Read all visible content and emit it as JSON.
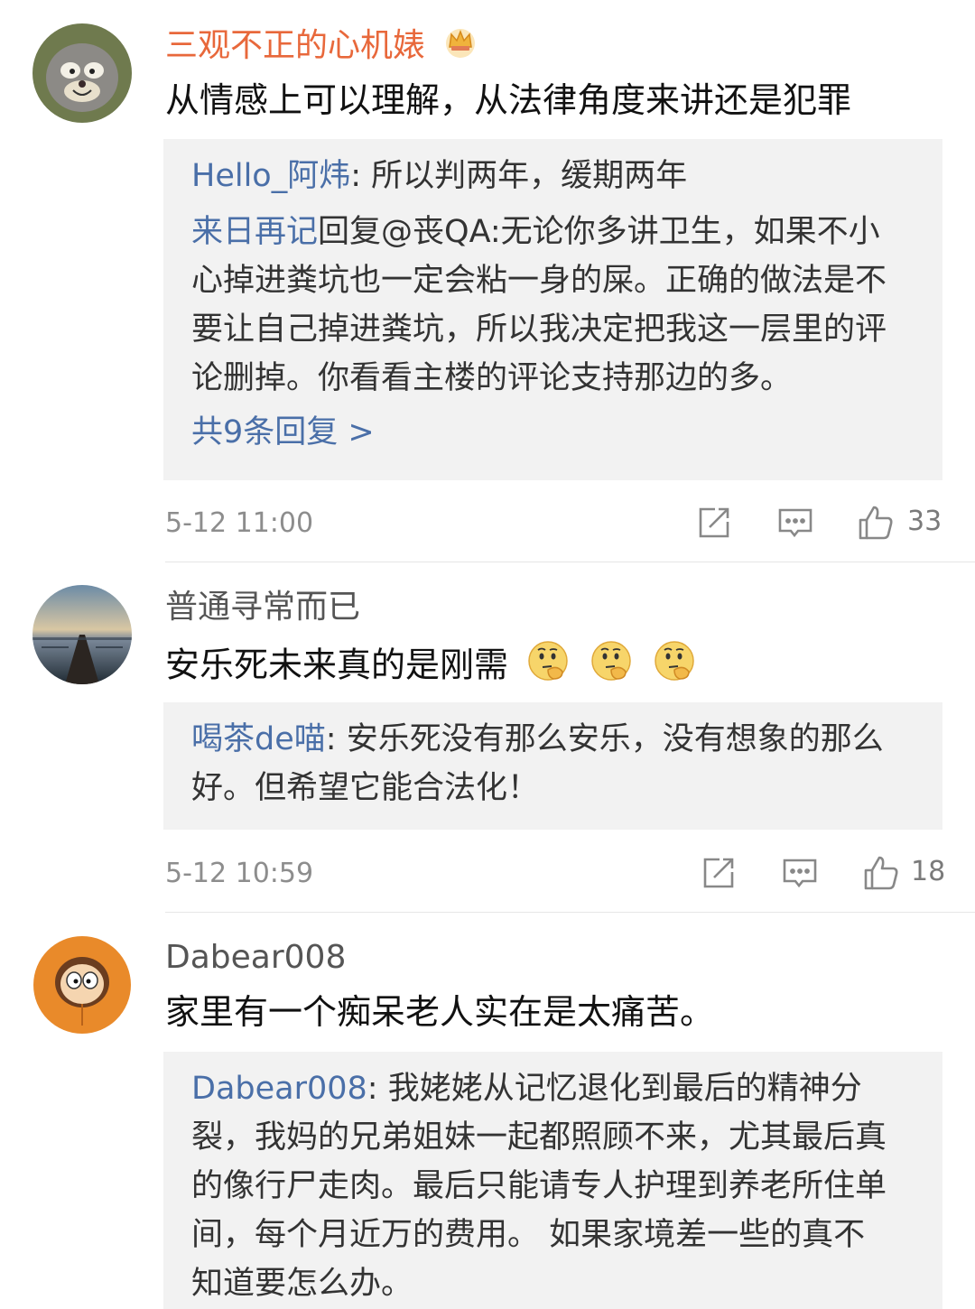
{
  "comments": [
    {
      "username": "三观不正的心机婊",
      "badge": "crown-badge-icon",
      "text": "从情感上可以理解，从法律角度来讲还是犯罪",
      "replies": [
        {
          "name": "Hello_阿炜",
          "sep": ": ",
          "text": "所以判两年，缓期两年"
        },
        {
          "name": "来日再记",
          "sep": "",
          "text_lines": [
            "回复@丧QA:无论你多讲卫生，如果不小",
            "心掉进粪坑也一定会粘一身的屎。正确的做法是不",
            "要让自己掉进粪坑，所以我决定把我这一层里的评",
            "论删掉。你看看主楼的评论支持那边的多。"
          ]
        }
      ],
      "more": "共9条回复 >",
      "time": "5-12 11:00",
      "likes": "33"
    },
    {
      "username": "普通寻常而已",
      "text": "安乐死未来真的是刚需",
      "emojis": [
        "thinking-face-icon",
        "thinking-face-icon",
        "thinking-face-icon"
      ],
      "replies": [
        {
          "name": "喝茶de喵",
          "sep": ": ",
          "text_lines": [
            "安乐死没有那么安乐，没有想象的那么",
            "好。但希望它能合法化！"
          ]
        }
      ],
      "time": "5-12 10:59",
      "likes": "18"
    },
    {
      "username": "Dabear008",
      "text": "家里有一个痴呆老人实在是太痛苦。",
      "replies": [
        {
          "name": "Dabear008",
          "sep": ": ",
          "text_lines": [
            "我姥姥从记忆退化到最后的精神分",
            "裂，我妈的兄弟姐妹一起都照顾不来，尤其最后真",
            "的像行尸走肉。最后只能请专人护理到养老所住单",
            "间，每个月近万的费用。 如果家境差一些的真不",
            "知道要怎么办。"
          ]
        }
      ]
    }
  ],
  "colors": {
    "link": "#4a6fa8",
    "username_vip": "#e8683b",
    "username": "#555555",
    "reply_bg": "#f2f2f2",
    "meta": "#8d8d8d"
  }
}
